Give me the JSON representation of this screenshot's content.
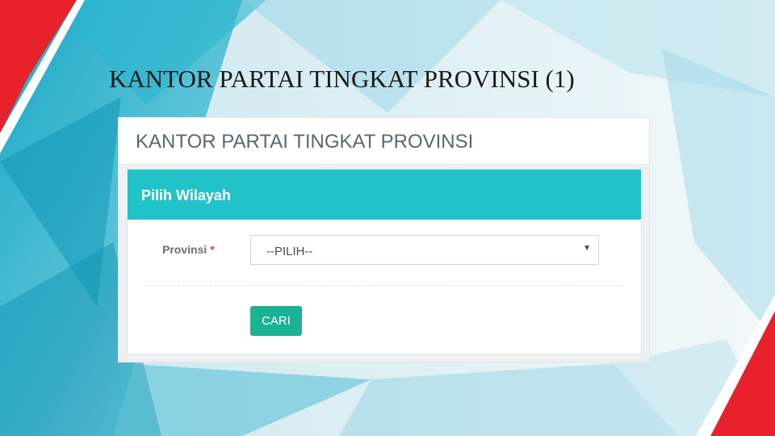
{
  "slide": {
    "title": "KANTOR PARTAI TINGKAT PROVINSI (1)"
  },
  "page": {
    "heading": "KANTOR PARTAI TINGKAT PROVINSI"
  },
  "box": {
    "title": "Pilih Wilayah"
  },
  "form": {
    "provinsi_label": "Provinsi",
    "required_marker": "*",
    "provinsi_value": "--PILIH--",
    "submit_label": "CARI"
  },
  "colors": {
    "box_header": "#22c3c8",
    "button": "#1ab394",
    "accent_red": "#e8212b"
  },
  "icons": {
    "select_caret": "caret-down-icon"
  }
}
